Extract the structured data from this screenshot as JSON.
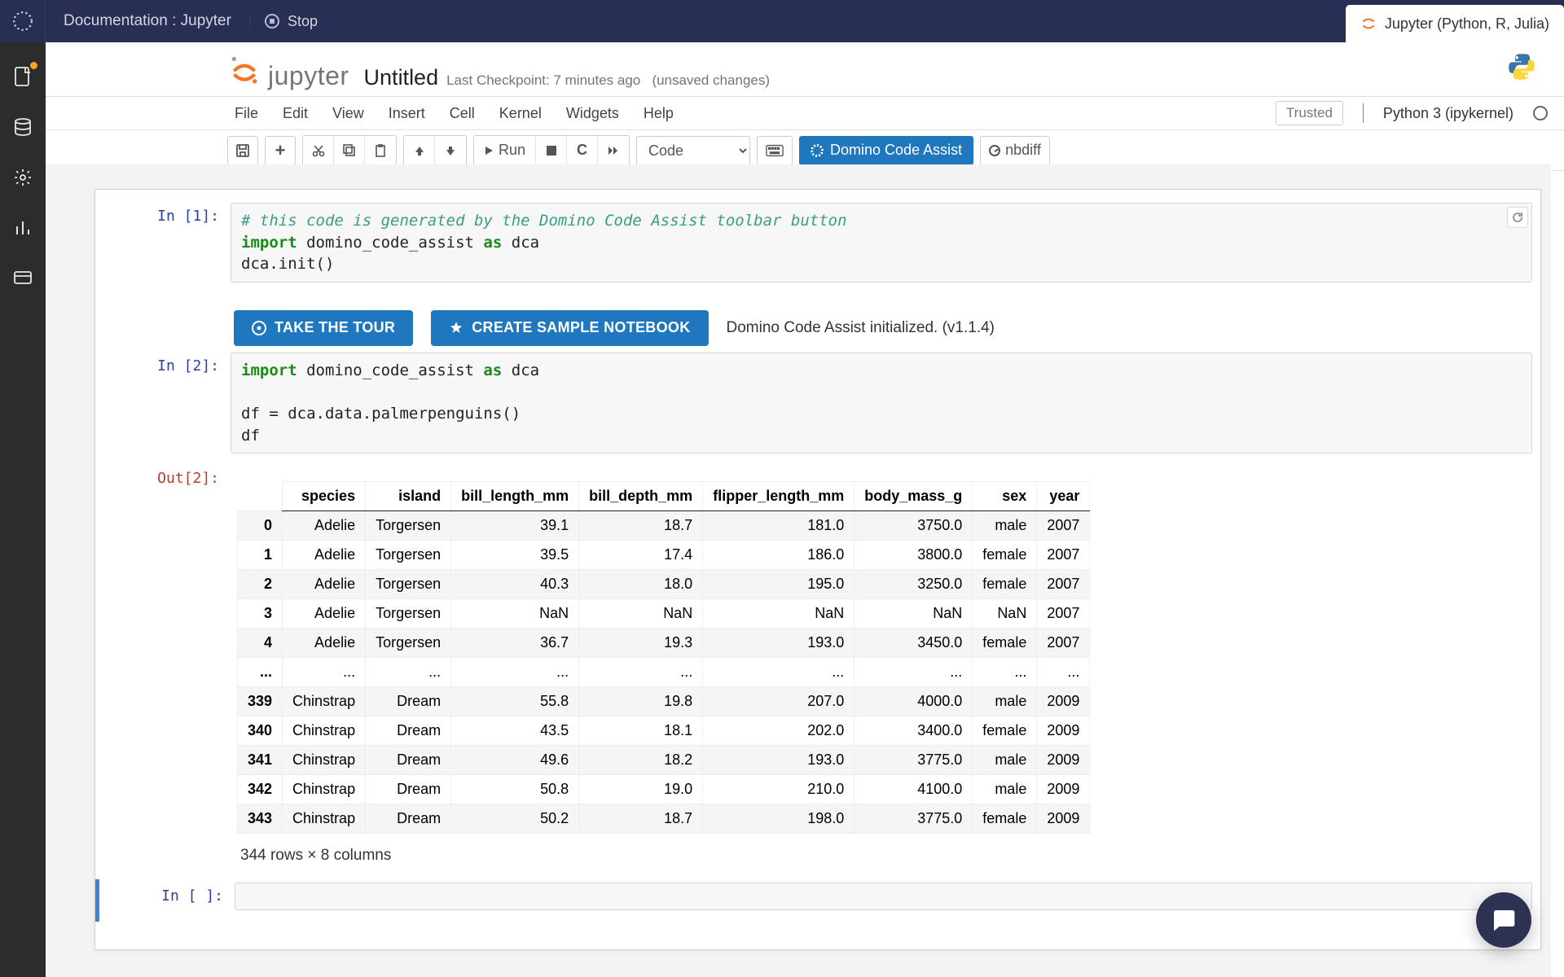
{
  "topbar": {
    "doc_title": "Documentation : Jupyter",
    "stop_label": "Stop",
    "env_tab_label": "Jupyter (Python, R, Julia)"
  },
  "header": {
    "jupyter_word": "jupyter",
    "nb_title": "Untitled",
    "checkpoint_prefix": "Last Checkpoint:",
    "checkpoint_time": "7 minutes ago",
    "unsaved": "(unsaved changes)"
  },
  "menus": {
    "file": "File",
    "edit": "Edit",
    "view": "View",
    "insert": "Insert",
    "cell": "Cell",
    "kernel": "Kernel",
    "widgets": "Widgets",
    "help": "Help"
  },
  "trusted": "Trusted",
  "kernel": "Python 3 (ipykernel)",
  "toolbar": {
    "run_label": "Run",
    "celltype": "Code",
    "domino_label": "Domino Code Assist",
    "nbdiff_label": "nbdiff"
  },
  "cell1": {
    "prompt": "In [1]:",
    "comment": "# this code is generated by the Domino Code Assist toolbar button",
    "import_kw": "import",
    "import_rest": " domino_code_assist ",
    "as_kw": "as",
    "as_rest": " dca",
    "line3": "dca.init()",
    "take_tour": "TAKE THE TOUR",
    "create_sample": "CREATE SAMPLE NOTEBOOK",
    "status": "Domino Code Assist initialized. (v1.1.4)"
  },
  "cell2": {
    "prompt": "In [2]:",
    "import_kw": "import",
    "import_rest": " domino_code_assist ",
    "as_kw": "as",
    "as_rest": " dca",
    "line2": "df = dca.data.palmerpenguins()",
    "line3": "df",
    "out_prompt": "Out[2]:",
    "summary": "344 rows × 8 columns"
  },
  "cell3": {
    "prompt": "In [ ]:"
  },
  "df": {
    "columns": [
      "species",
      "island",
      "bill_length_mm",
      "bill_depth_mm",
      "flipper_length_mm",
      "body_mass_g",
      "sex",
      "year"
    ],
    "rows": [
      {
        "idx": "0",
        "v": [
          "Adelie",
          "Torgersen",
          "39.1",
          "18.7",
          "181.0",
          "3750.0",
          "male",
          "2007"
        ]
      },
      {
        "idx": "1",
        "v": [
          "Adelie",
          "Torgersen",
          "39.5",
          "17.4",
          "186.0",
          "3800.0",
          "female",
          "2007"
        ]
      },
      {
        "idx": "2",
        "v": [
          "Adelie",
          "Torgersen",
          "40.3",
          "18.0",
          "195.0",
          "3250.0",
          "female",
          "2007"
        ]
      },
      {
        "idx": "3",
        "v": [
          "Adelie",
          "Torgersen",
          "NaN",
          "NaN",
          "NaN",
          "NaN",
          "NaN",
          "2007"
        ]
      },
      {
        "idx": "4",
        "v": [
          "Adelie",
          "Torgersen",
          "36.7",
          "19.3",
          "193.0",
          "3450.0",
          "female",
          "2007"
        ]
      },
      {
        "idx": "...",
        "v": [
          "...",
          "...",
          "...",
          "...",
          "...",
          "...",
          "...",
          "..."
        ]
      },
      {
        "idx": "339",
        "v": [
          "Chinstrap",
          "Dream",
          "55.8",
          "19.8",
          "207.0",
          "4000.0",
          "male",
          "2009"
        ]
      },
      {
        "idx": "340",
        "v": [
          "Chinstrap",
          "Dream",
          "43.5",
          "18.1",
          "202.0",
          "3400.0",
          "female",
          "2009"
        ]
      },
      {
        "idx": "341",
        "v": [
          "Chinstrap",
          "Dream",
          "49.6",
          "18.2",
          "193.0",
          "3775.0",
          "male",
          "2009"
        ]
      },
      {
        "idx": "342",
        "v": [
          "Chinstrap",
          "Dream",
          "50.8",
          "19.0",
          "210.0",
          "4100.0",
          "male",
          "2009"
        ]
      },
      {
        "idx": "343",
        "v": [
          "Chinstrap",
          "Dream",
          "50.2",
          "18.7",
          "198.0",
          "3775.0",
          "female",
          "2009"
        ]
      }
    ]
  }
}
